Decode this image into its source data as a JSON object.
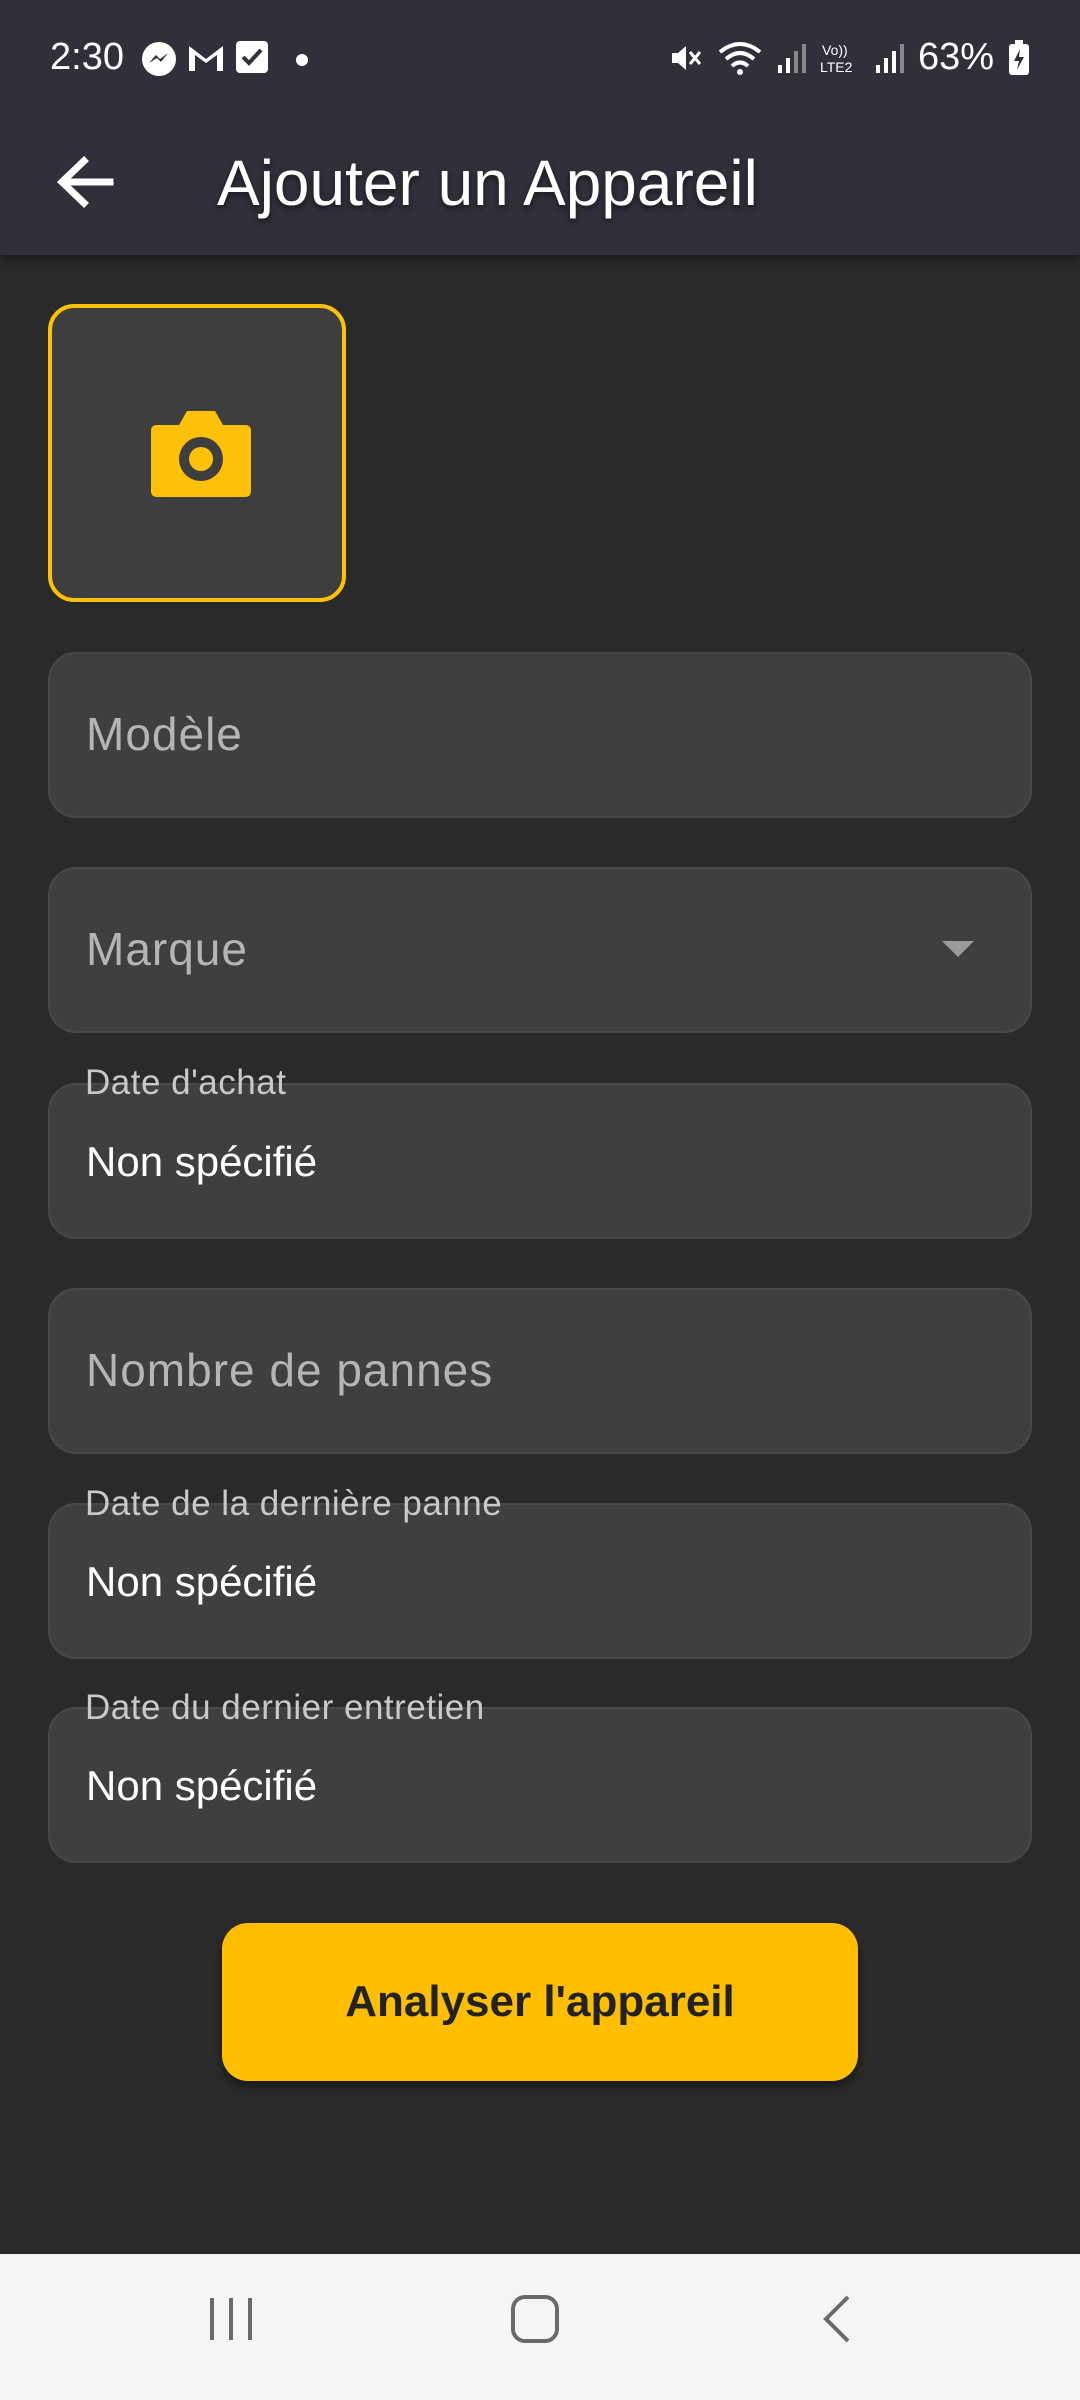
{
  "status_bar": {
    "time": "2:30",
    "battery": "63%",
    "left_icons": [
      "messenger-icon",
      "gmail-icon",
      "tasks-icon",
      "dot-icon"
    ],
    "right_icons": [
      "mute-icon",
      "wifi-icon",
      "signal-icon",
      "volte-icon",
      "signal-icon",
      "battery-icon"
    ]
  },
  "app_bar": {
    "title": "Ajouter un Appareil"
  },
  "form": {
    "photo": {
      "icon": "camera-icon"
    },
    "model": {
      "placeholder": "Modèle"
    },
    "brand": {
      "placeholder": "Marque"
    },
    "purchase_date": {
      "label": "Date d'achat",
      "value": "Non spécifié"
    },
    "failure_count": {
      "placeholder": "Nombre de pannes"
    },
    "last_failure_date": {
      "label": "Date de la dernière panne",
      "value": "Non spécifié"
    },
    "last_maintenance_date": {
      "label": "Date du dernier entretien",
      "value": "Non spécifié"
    },
    "submit_label": "Analyser l'appareil"
  },
  "colors": {
    "accent": "#ffc107",
    "background": "#2a2a2a",
    "app_bar": "#302f3a",
    "field": "#3f3f3f",
    "button": "#ffbf00"
  }
}
